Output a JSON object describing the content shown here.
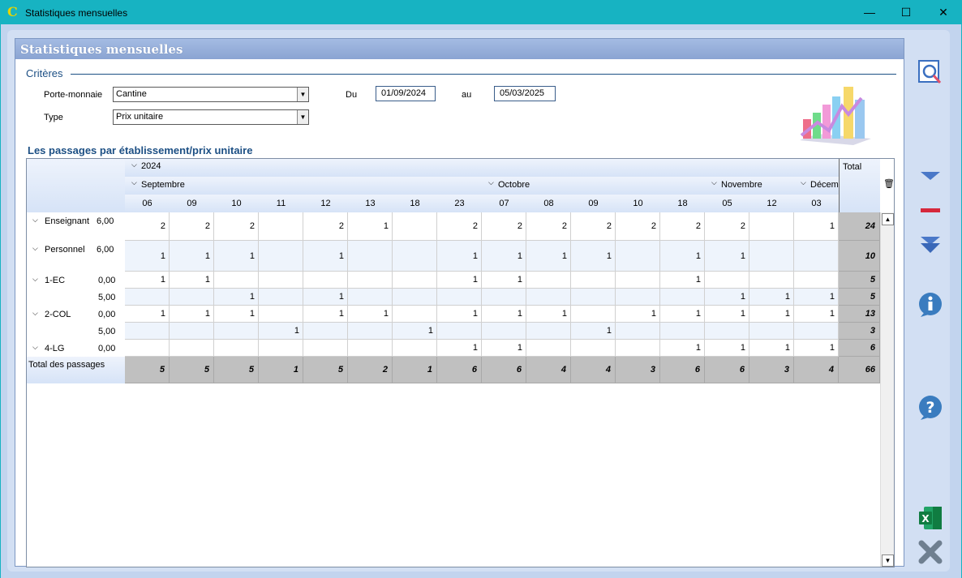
{
  "window": {
    "title": "Statistiques mensuelles",
    "minimize": "—",
    "maximize": "☐",
    "close": "✕",
    "app_icon_letter": "C"
  },
  "panel": {
    "title": "Statistiques mensuelles"
  },
  "criteria": {
    "section_label": "Critères",
    "wallet_label": "Porte-monnaie",
    "wallet_value": "Cantine",
    "type_label": "Type",
    "type_value": "Prix unitaire",
    "from_label": "Du",
    "from_value": "01/09/2024",
    "to_label": "au",
    "to_value": "05/03/2025"
  },
  "table": {
    "title": "Les passages par établissement/prix unitaire",
    "year": "2024",
    "months": [
      {
        "label": "Septembre"
      },
      {
        "label": "Octobre"
      },
      {
        "label": "Novembre"
      },
      {
        "label": "Décem"
      }
    ],
    "days": [
      "06",
      "09",
      "10",
      "11",
      "12",
      "13",
      "18",
      "23",
      "07",
      "08",
      "09",
      "10",
      "18",
      "05",
      "12",
      "03"
    ],
    "total_header": "Total",
    "rows": [
      {
        "name": "Enseignant",
        "price": "6,00",
        "expand": true,
        "cells": [
          "2",
          "2",
          "2",
          "",
          "2",
          "1",
          "",
          "2",
          "2",
          "2",
          "2",
          "2",
          "2",
          "2",
          "",
          "1"
        ],
        "total": "24"
      },
      {
        "name": "Personnel",
        "price": "6,00",
        "expand": true,
        "cells": [
          "1",
          "1",
          "1",
          "",
          "1",
          "",
          "",
          "1",
          "1",
          "1",
          "1",
          "",
          "1",
          "1",
          "",
          ""
        ],
        "total": "10"
      },
      {
        "name": "1-EC",
        "price": "0,00",
        "expand": true,
        "cells": [
          "1",
          "1",
          "",
          "",
          "",
          "",
          "",
          "1",
          "1",
          "",
          "",
          "",
          "1",
          "",
          "",
          ""
        ],
        "total": "5"
      },
      {
        "name": "",
        "price": "5,00",
        "expand": false,
        "cells": [
          "",
          "",
          "1",
          "",
          "1",
          "",
          "",
          "",
          "",
          "",
          "",
          "",
          "",
          "1",
          "1",
          "1"
        ],
        "total": "5"
      },
      {
        "name": "2-COL",
        "price": "0,00",
        "expand": true,
        "cells": [
          "1",
          "1",
          "1",
          "",
          "1",
          "1",
          "",
          "1",
          "1",
          "1",
          "",
          "1",
          "1",
          "1",
          "1",
          "1"
        ],
        "total": "13"
      },
      {
        "name": "",
        "price": "5,00",
        "expand": false,
        "cells": [
          "",
          "",
          "",
          "1",
          "",
          "",
          "1",
          "",
          "",
          "",
          "1",
          "",
          "",
          "",
          "",
          ""
        ],
        "total": "3"
      },
      {
        "name": "4-LG",
        "price": "0,00",
        "expand": true,
        "cells": [
          "",
          "",
          "",
          "",
          "",
          "",
          "",
          "1",
          "1",
          "",
          "",
          "",
          "1",
          "1",
          "1",
          "1"
        ],
        "total": "6"
      }
    ],
    "total_row": {
      "label": "Total des passages",
      "cells": [
        "5",
        "5",
        "5",
        "1",
        "5",
        "2",
        "1",
        "6",
        "6",
        "4",
        "4",
        "3",
        "6",
        "6",
        "3",
        "4"
      ],
      "total": "66"
    }
  },
  "side_toolbar": {
    "search": "search-icon",
    "expand": "expand-icon",
    "collapse": "collapse-icon",
    "expand_all": "expand-all-icon",
    "info": "info-icon",
    "help": "help-icon",
    "excel": "excel-icon",
    "close": "close-icon"
  },
  "colors": {
    "titlebar": "#17b3c2",
    "accent": "#1c4f84",
    "total_bg": "#c0c0c0",
    "alt_row": "#eef4fc"
  }
}
